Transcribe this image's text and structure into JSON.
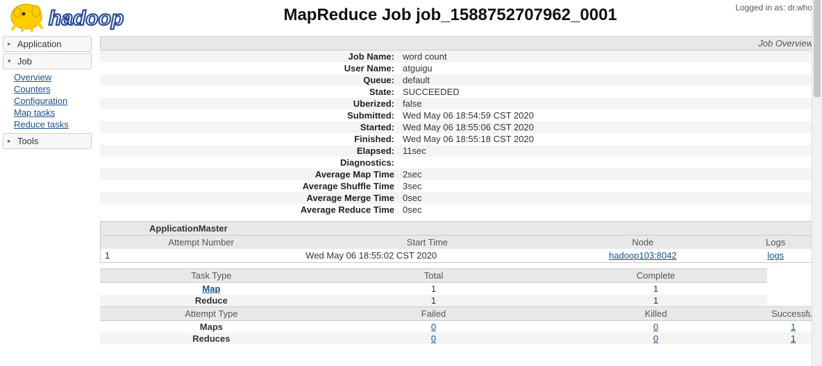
{
  "login_prefix": "Logged in as: ",
  "login_user": "dr.who",
  "page_title": "MapReduce Job job_1588752707962_0001",
  "nav": {
    "application": "Application",
    "job": "Job",
    "job_items": {
      "overview": "Overview",
      "counters": "Counters",
      "configuration": "Configuration",
      "map_tasks": "Map tasks",
      "reduce_tasks": "Reduce tasks"
    },
    "tools": "Tools"
  },
  "overview_header": "Job Overview",
  "info": {
    "job_name": {
      "k": "Job Name:",
      "v": "word count"
    },
    "user_name": {
      "k": "User Name:",
      "v": "atguigu"
    },
    "queue": {
      "k": "Queue:",
      "v": "default"
    },
    "state": {
      "k": "State:",
      "v": "SUCCEEDED"
    },
    "uberized": {
      "k": "Uberized:",
      "v": "false"
    },
    "submitted": {
      "k": "Submitted:",
      "v": "Wed May 06 18:54:59 CST 2020"
    },
    "started": {
      "k": "Started:",
      "v": "Wed May 06 18:55:06 CST 2020"
    },
    "finished": {
      "k": "Finished:",
      "v": "Wed May 06 18:55:18 CST 2020"
    },
    "elapsed": {
      "k": "Elapsed:",
      "v": "11sec"
    },
    "diagnostics": {
      "k": "Diagnostics:",
      "v": ""
    },
    "avg_map": {
      "k": "Average Map Time",
      "v": "2sec"
    },
    "avg_shuffle": {
      "k": "Average Shuffle Time",
      "v": "3sec"
    },
    "avg_merge": {
      "k": "Average Merge Time",
      "v": "0sec"
    },
    "avg_reduce": {
      "k": "Average Reduce Time",
      "v": "0sec"
    }
  },
  "am": {
    "title": "ApplicationMaster",
    "cols": {
      "attempt": "Attempt Number",
      "start": "Start Time",
      "node": "Node",
      "logs": "Logs"
    },
    "row": {
      "attempt": "1",
      "start": "Wed May 06 18:55:02 CST 2020",
      "node": "hadoop103:8042",
      "logs": "logs"
    }
  },
  "tasks": {
    "cols": {
      "type": "Task Type",
      "total": "Total",
      "complete": "Complete"
    },
    "map": {
      "label": "Map",
      "total": "1",
      "complete": "1"
    },
    "reduce": {
      "label": "Reduce",
      "total": "1",
      "complete": "1"
    }
  },
  "attempts": {
    "cols": {
      "type": "Attempt Type",
      "failed": "Failed",
      "killed": "Killed",
      "successful": "Successful"
    },
    "maps": {
      "label": "Maps",
      "failed": "0",
      "killed": "0",
      "successful": "1"
    },
    "reduces": {
      "label": "Reduces",
      "failed": "0",
      "killed": "0",
      "successful": "1"
    }
  }
}
